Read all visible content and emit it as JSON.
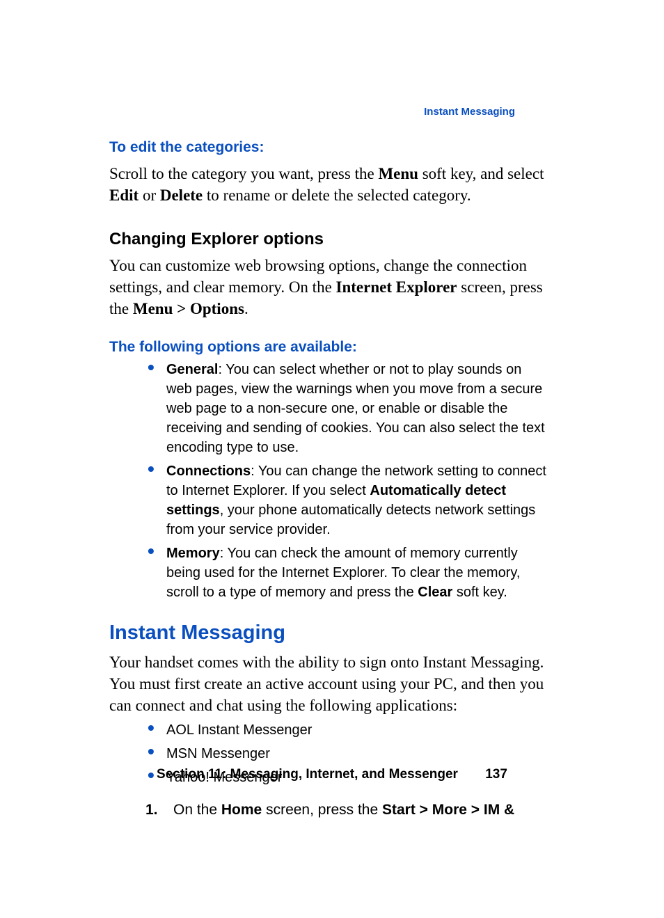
{
  "running_head": "Instant Messaging",
  "sub1_title": "To edit the categories:",
  "sub1_body_parts": [
    "Scroll to the category you want, press the ",
    "Menu",
    " soft key, and select ",
    "Edit",
    " or ",
    "Delete",
    " to rename or delete the selected category."
  ],
  "h3_title": "Changing Explorer options",
  "h3_body_parts": [
    "You can customize web browsing options, change the connection settings, and clear memory. On the ",
    "Internet Explorer",
    " screen, press the ",
    "Menu > Options",
    "."
  ],
  "sub2_title": "The following options are available:",
  "options": [
    {
      "bold": "General",
      "rest": ": You can select whether or not to play sounds on web pages, view the warnings when you move from a secure web page to a non-secure one, or enable or disable the receiving and sending of cookies. You can also select the text encoding type to use."
    },
    {
      "bold": "Connections",
      "rest_parts": [
        ": You can change the network setting to connect to Internet Explorer. If you select ",
        "Automatically detect settings",
        ", your phone automatically detects network settings from your service provider."
      ]
    },
    {
      "bold": "Memory",
      "rest_parts": [
        ": You can check the amount of memory currently being used for the Internet Explorer. To clear the memory, scroll to a type of memory and press the ",
        "Clear",
        " soft key."
      ]
    }
  ],
  "h2_title": "Instant Messaging",
  "h2_body": "Your handset comes with the ability to sign onto Instant Messaging. You must first create an active account using your PC, and then you can connect and chat using the following applications:",
  "apps": [
    "AOL Instant Messenger",
    "MSN Messenger",
    "Yahoo! Messenger"
  ],
  "step1_parts": [
    "On the ",
    "Home",
    " screen, press the ",
    "Start > More > IM &"
  ],
  "step1_num": "1.",
  "footer_section": "Section 11: Messaging, Internet, and Messenger",
  "footer_page": "137"
}
